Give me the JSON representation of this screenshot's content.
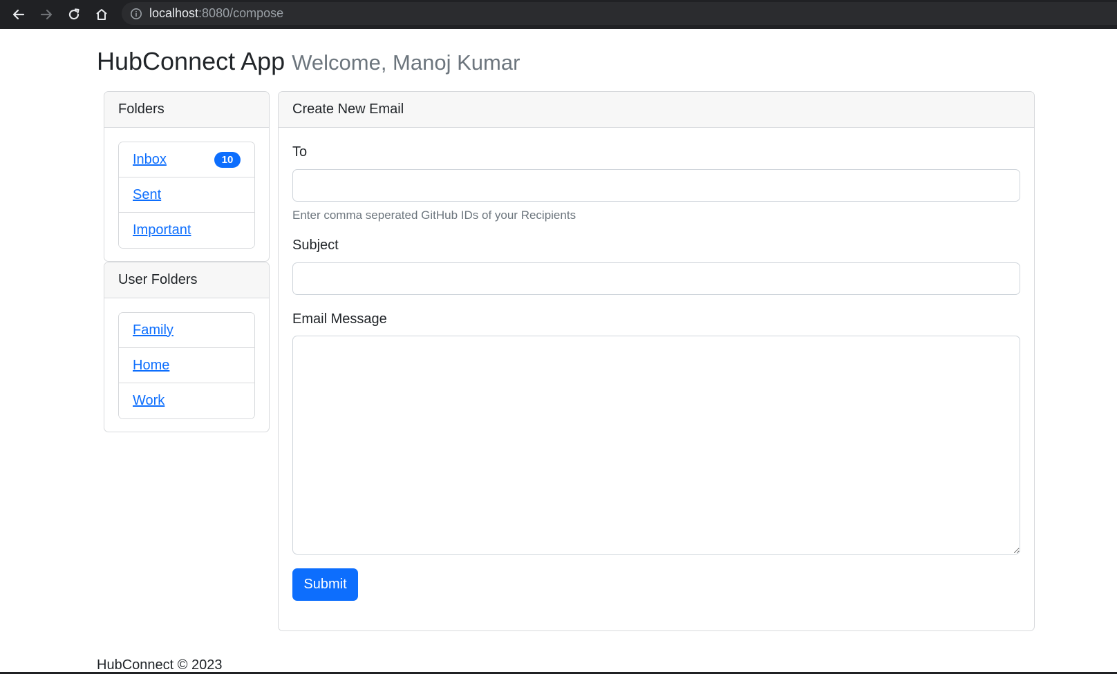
{
  "browser": {
    "url_host": "localhost",
    "url_path": ":8080/compose",
    "back_icon": "back-arrow-icon",
    "forward_icon": "forward-arrow-icon",
    "reload_icon": "reload-icon",
    "home_icon": "home-icon",
    "info_icon": "info-icon"
  },
  "header": {
    "app_title": "HubConnect App",
    "welcome": "Welcome, Manoj Kumar"
  },
  "sidebar": {
    "folders_title": "Folders",
    "folders": [
      {
        "label": "Inbox",
        "badge": "10"
      },
      {
        "label": "Sent"
      },
      {
        "label": "Important"
      }
    ],
    "user_folders_title": "User Folders",
    "user_folders": [
      {
        "label": "Family"
      },
      {
        "label": "Home"
      },
      {
        "label": "Work"
      }
    ]
  },
  "compose": {
    "title": "Create New Email",
    "to_label": "To",
    "to_value": "",
    "to_help": "Enter comma seperated GitHub IDs of your Recipients",
    "subject_label": "Subject",
    "subject_value": "",
    "message_label": "Email Message",
    "message_value": "",
    "submit_label": "Submit"
  },
  "footer": {
    "text": "HubConnect © 2023"
  },
  "colors": {
    "primary": "#0d6efd",
    "muted": "#6c757d",
    "browser_chrome": "#202124"
  }
}
